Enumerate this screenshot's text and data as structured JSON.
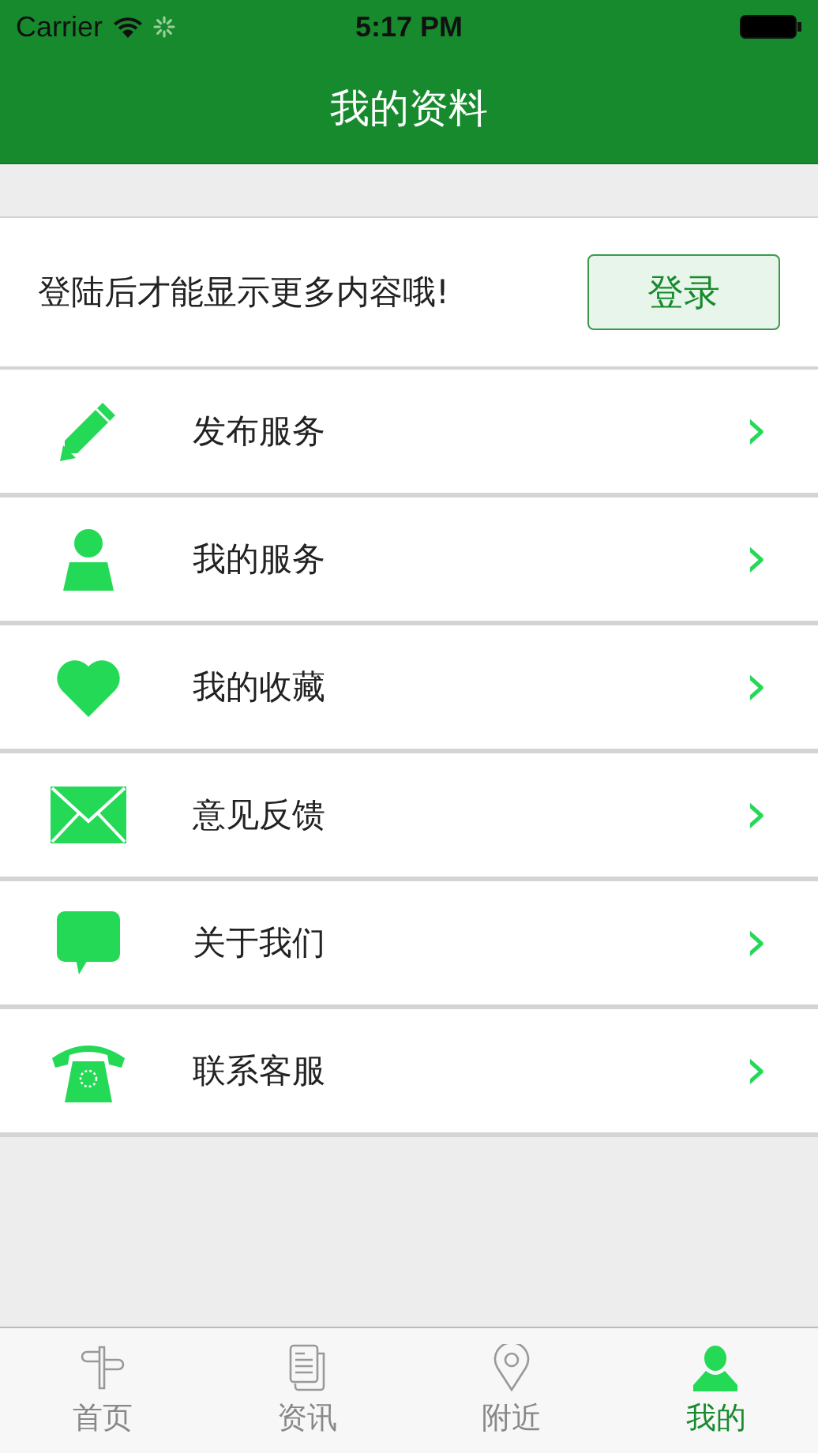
{
  "status_bar": {
    "carrier": "Carrier",
    "time": "5:17 PM"
  },
  "nav": {
    "title": "我的资料"
  },
  "login": {
    "message": "登陆后才能显示更多内容哦!",
    "button": "登录"
  },
  "menu": [
    {
      "label": "发布服务",
      "chevron": "›"
    },
    {
      "label": "我的服务",
      "chevron": "›"
    },
    {
      "label": "我的收藏",
      "chevron": "›"
    },
    {
      "label": "意见反馈",
      "chevron": "›"
    },
    {
      "label": "关于我们",
      "chevron": "›"
    },
    {
      "label": "联系客服",
      "chevron": "›"
    }
  ],
  "tabs": [
    {
      "label": "首页",
      "selected": false
    },
    {
      "label": "资讯",
      "selected": false
    },
    {
      "label": "附近",
      "selected": false
    },
    {
      "label": "我的",
      "selected": true
    }
  ]
}
